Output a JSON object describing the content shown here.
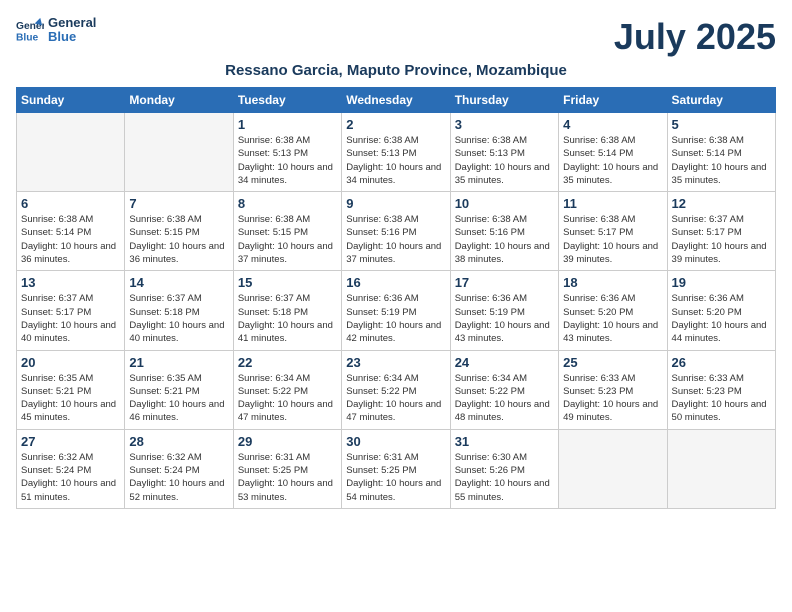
{
  "logo": {
    "line1": "General",
    "line2": "Blue"
  },
  "title": "July 2025",
  "location": "Ressano Garcia, Maputo Province, Mozambique",
  "days_of_week": [
    "Sunday",
    "Monday",
    "Tuesday",
    "Wednesday",
    "Thursday",
    "Friday",
    "Saturday"
  ],
  "weeks": [
    [
      {
        "day": "",
        "info": ""
      },
      {
        "day": "",
        "info": ""
      },
      {
        "day": "1",
        "info": "Sunrise: 6:38 AM\nSunset: 5:13 PM\nDaylight: 10 hours and 34 minutes."
      },
      {
        "day": "2",
        "info": "Sunrise: 6:38 AM\nSunset: 5:13 PM\nDaylight: 10 hours and 34 minutes."
      },
      {
        "day": "3",
        "info": "Sunrise: 6:38 AM\nSunset: 5:13 PM\nDaylight: 10 hours and 35 minutes."
      },
      {
        "day": "4",
        "info": "Sunrise: 6:38 AM\nSunset: 5:14 PM\nDaylight: 10 hours and 35 minutes."
      },
      {
        "day": "5",
        "info": "Sunrise: 6:38 AM\nSunset: 5:14 PM\nDaylight: 10 hours and 35 minutes."
      }
    ],
    [
      {
        "day": "6",
        "info": "Sunrise: 6:38 AM\nSunset: 5:14 PM\nDaylight: 10 hours and 36 minutes."
      },
      {
        "day": "7",
        "info": "Sunrise: 6:38 AM\nSunset: 5:15 PM\nDaylight: 10 hours and 36 minutes."
      },
      {
        "day": "8",
        "info": "Sunrise: 6:38 AM\nSunset: 5:15 PM\nDaylight: 10 hours and 37 minutes."
      },
      {
        "day": "9",
        "info": "Sunrise: 6:38 AM\nSunset: 5:16 PM\nDaylight: 10 hours and 37 minutes."
      },
      {
        "day": "10",
        "info": "Sunrise: 6:38 AM\nSunset: 5:16 PM\nDaylight: 10 hours and 38 minutes."
      },
      {
        "day": "11",
        "info": "Sunrise: 6:38 AM\nSunset: 5:17 PM\nDaylight: 10 hours and 39 minutes."
      },
      {
        "day": "12",
        "info": "Sunrise: 6:37 AM\nSunset: 5:17 PM\nDaylight: 10 hours and 39 minutes."
      }
    ],
    [
      {
        "day": "13",
        "info": "Sunrise: 6:37 AM\nSunset: 5:17 PM\nDaylight: 10 hours and 40 minutes."
      },
      {
        "day": "14",
        "info": "Sunrise: 6:37 AM\nSunset: 5:18 PM\nDaylight: 10 hours and 40 minutes."
      },
      {
        "day": "15",
        "info": "Sunrise: 6:37 AM\nSunset: 5:18 PM\nDaylight: 10 hours and 41 minutes."
      },
      {
        "day": "16",
        "info": "Sunrise: 6:36 AM\nSunset: 5:19 PM\nDaylight: 10 hours and 42 minutes."
      },
      {
        "day": "17",
        "info": "Sunrise: 6:36 AM\nSunset: 5:19 PM\nDaylight: 10 hours and 43 minutes."
      },
      {
        "day": "18",
        "info": "Sunrise: 6:36 AM\nSunset: 5:20 PM\nDaylight: 10 hours and 43 minutes."
      },
      {
        "day": "19",
        "info": "Sunrise: 6:36 AM\nSunset: 5:20 PM\nDaylight: 10 hours and 44 minutes."
      }
    ],
    [
      {
        "day": "20",
        "info": "Sunrise: 6:35 AM\nSunset: 5:21 PM\nDaylight: 10 hours and 45 minutes."
      },
      {
        "day": "21",
        "info": "Sunrise: 6:35 AM\nSunset: 5:21 PM\nDaylight: 10 hours and 46 minutes."
      },
      {
        "day": "22",
        "info": "Sunrise: 6:34 AM\nSunset: 5:22 PM\nDaylight: 10 hours and 47 minutes."
      },
      {
        "day": "23",
        "info": "Sunrise: 6:34 AM\nSunset: 5:22 PM\nDaylight: 10 hours and 47 minutes."
      },
      {
        "day": "24",
        "info": "Sunrise: 6:34 AM\nSunset: 5:22 PM\nDaylight: 10 hours and 48 minutes."
      },
      {
        "day": "25",
        "info": "Sunrise: 6:33 AM\nSunset: 5:23 PM\nDaylight: 10 hours and 49 minutes."
      },
      {
        "day": "26",
        "info": "Sunrise: 6:33 AM\nSunset: 5:23 PM\nDaylight: 10 hours and 50 minutes."
      }
    ],
    [
      {
        "day": "27",
        "info": "Sunrise: 6:32 AM\nSunset: 5:24 PM\nDaylight: 10 hours and 51 minutes."
      },
      {
        "day": "28",
        "info": "Sunrise: 6:32 AM\nSunset: 5:24 PM\nDaylight: 10 hours and 52 minutes."
      },
      {
        "day": "29",
        "info": "Sunrise: 6:31 AM\nSunset: 5:25 PM\nDaylight: 10 hours and 53 minutes."
      },
      {
        "day": "30",
        "info": "Sunrise: 6:31 AM\nSunset: 5:25 PM\nDaylight: 10 hours and 54 minutes."
      },
      {
        "day": "31",
        "info": "Sunrise: 6:30 AM\nSunset: 5:26 PM\nDaylight: 10 hours and 55 minutes."
      },
      {
        "day": "",
        "info": ""
      },
      {
        "day": "",
        "info": ""
      }
    ]
  ]
}
